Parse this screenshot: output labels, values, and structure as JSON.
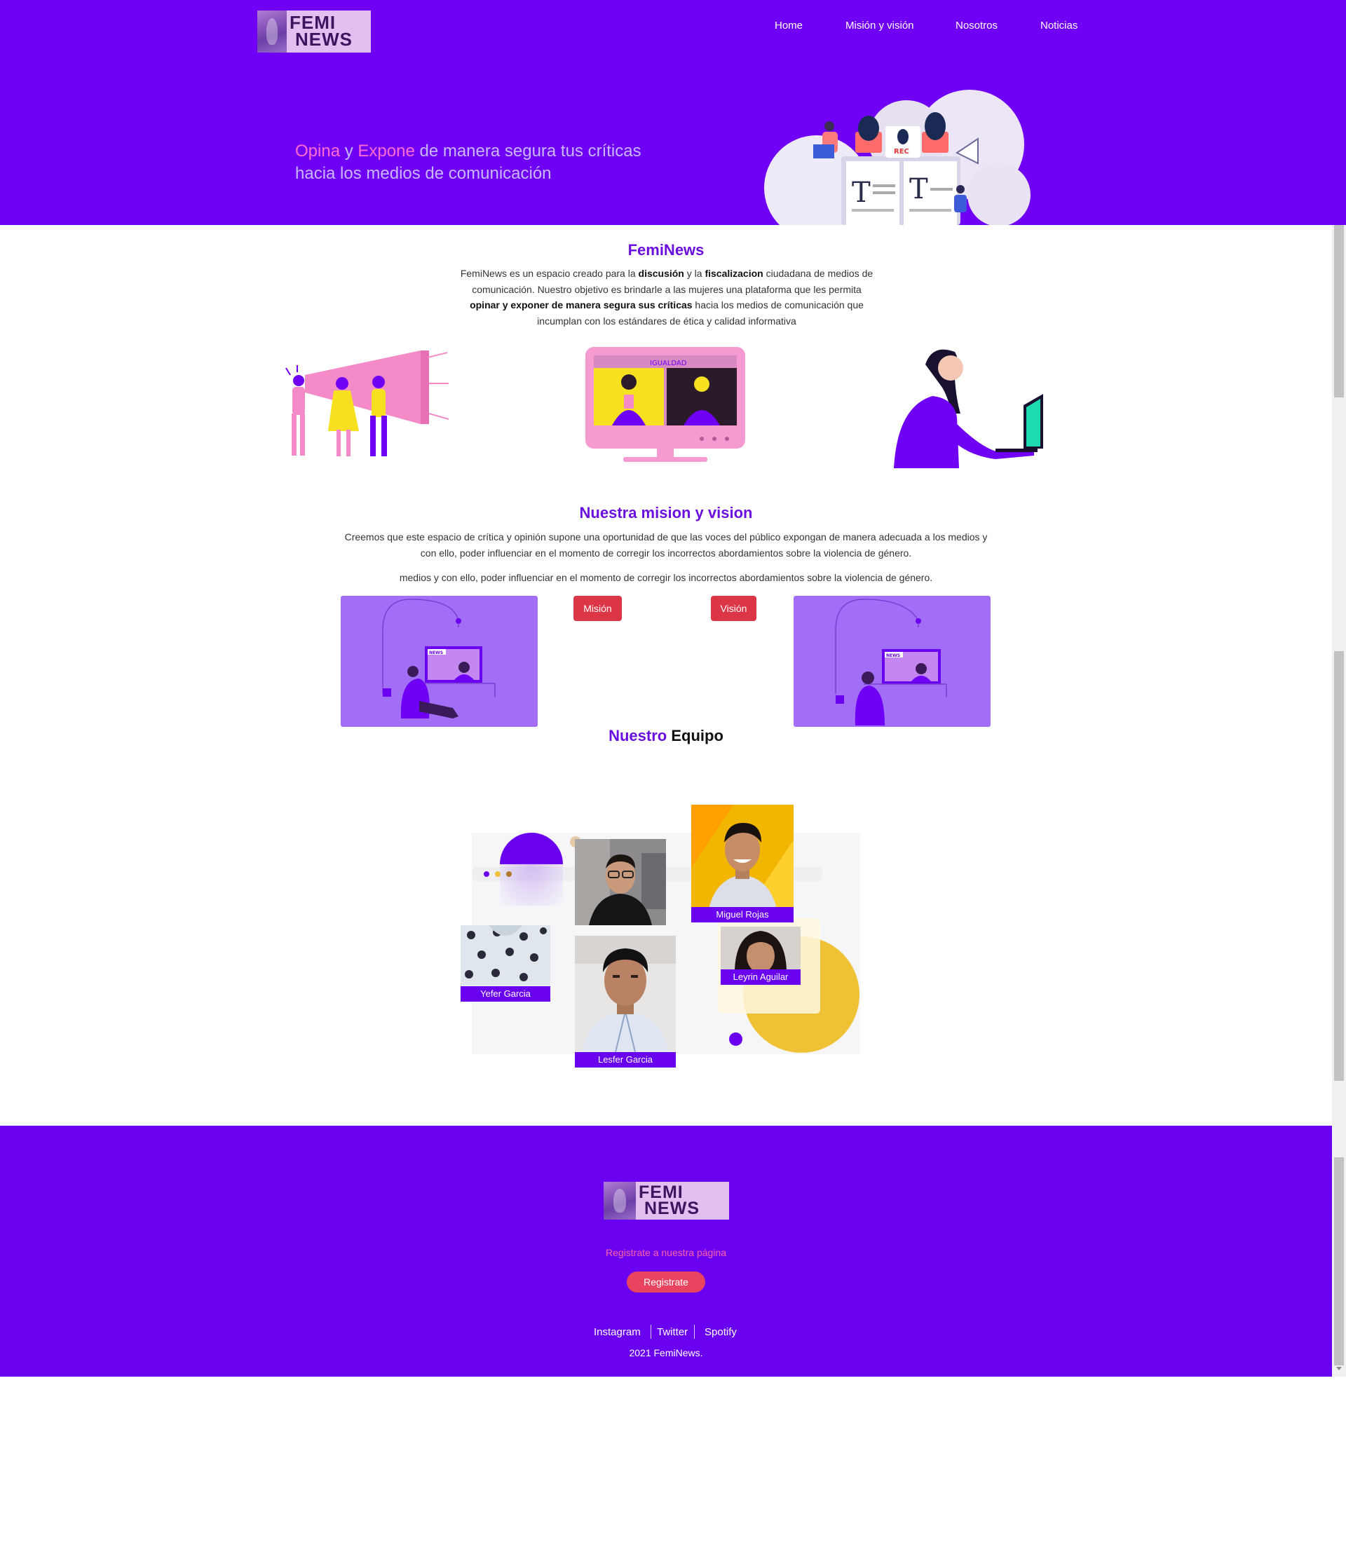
{
  "header": {
    "logo": {
      "line1": "FEMI",
      "line2": "NEWS"
    },
    "nav": [
      "Home",
      "Misión y visión",
      "Nosotros",
      "Noticias"
    ]
  },
  "hero": {
    "accent1": "Opina",
    "y_word": " y ",
    "accent2": "Expone",
    "rest_line1": " de manera segura tus críticas",
    "line2": "hacia los medios de comunicación",
    "illustration": {
      "rec_label": "REC",
      "letter": "T"
    }
  },
  "about": {
    "title": "FemiNews",
    "p_parts": [
      "FemiNews es un espacio creado para la ",
      "discusión",
      " y la ",
      "fiscalizacion",
      " ciudadana de medios de comunicación. Nuestro objetivo es brindarle a las mujeres una plataforma que les permita ",
      "opinar y exponer de manera segura sus críticas",
      " hacia los medios de comunicación que incumplan con los estándares de ética y calidad informativa"
    ],
    "monitor_caption": "IGUALDAD"
  },
  "mission": {
    "title": "Nuestra mision y vision",
    "paragraph1": "Creemos que este espacio de crítica y opinión supone una oportunidad de que las voces del público expongan de manera adecuada a los medios y con ello, poder influenciar en el momento de corregir los incorrectos abordamientos sobre la violencia de género.",
    "paragraph2": "medios y con ello, poder influenciar en el momento de corregir los incorrectos abordamientos sobre la violencia de género.",
    "mision_button": "Misión",
    "vision_button": "Visión",
    "tv_label": "NEWS"
  },
  "team": {
    "title_accent": "Nuestro",
    "title_rest": " Equipo",
    "members": [
      "Miguel Rojas",
      "Yefer Garcia",
      "Leyrin Aguilar",
      "Lesfer Garcia"
    ]
  },
  "footer": {
    "logo": {
      "line1": "FEMI",
      "line2": "NEWS"
    },
    "cta_text": "Registrate a nuestra página",
    "cta_button": "Registrate",
    "social": [
      "Instagram",
      "Twitter",
      "Spotify"
    ],
    "copyright": "2021 FemiNews."
  },
  "colors": {
    "brand_purple": "#7000f5",
    "title_purple": "#6a0fe0",
    "button_red": "#dc3545",
    "cta_pink": "#ff5fa8",
    "register_button": "#e8445f"
  }
}
